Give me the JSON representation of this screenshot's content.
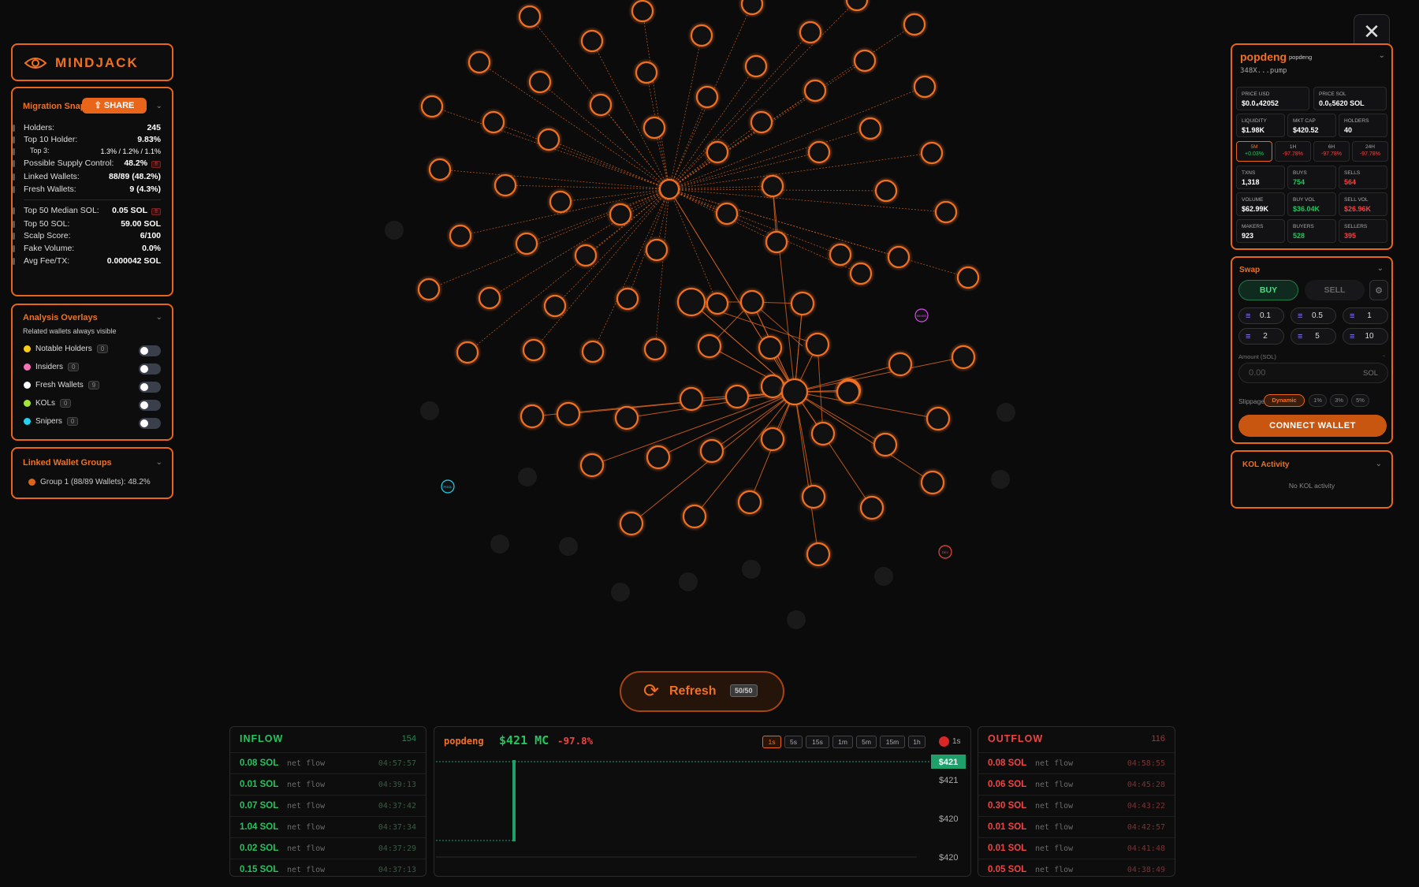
{
  "brand": {
    "name": "MINDJACK",
    "accent": "#f07022"
  },
  "close_icon": "close-icon",
  "migration": {
    "title": "Migration Snap",
    "share_label": "SHARE",
    "rows": [
      {
        "label": "Holders:",
        "value": "245"
      },
      {
        "label": "Top 10 Holder:",
        "value": "9.83%"
      },
      {
        "label": "Top 3:",
        "value": "1.3% / 1.2% / 1.1%"
      },
      {
        "label": "Possible Supply Control:",
        "value": "48.2%",
        "flag": "!!"
      },
      {
        "label": "Linked Wallets:",
        "value": "88/89 (48.2%)"
      },
      {
        "label": "Fresh Wallets:",
        "value": "9 (4.3%)"
      },
      {
        "label": "Top 50 Median SOL:",
        "value": "0.05 SOL",
        "flag": "!!"
      },
      {
        "label": "Top 50 SOL:",
        "value": "59.00 SOL"
      },
      {
        "label": "Scalp Score:",
        "value": "6/100"
      },
      {
        "label": "Fake Volume:",
        "value": "0.0%"
      },
      {
        "label": "Avg Fee/TX:",
        "value": "0.000042 SOL"
      }
    ]
  },
  "overlays": {
    "title": "Analysis Overlays",
    "subtitle": "Related wallets always visible",
    "items": [
      {
        "label": "Notable Holders",
        "count": "0",
        "color": "#facc15"
      },
      {
        "label": "Insiders",
        "count": "0",
        "color": "#f472b6"
      },
      {
        "label": "Fresh Wallets",
        "count": "9",
        "color": "#ffffff"
      },
      {
        "label": "KOLs",
        "count": "0",
        "color": "#a3e635"
      },
      {
        "label": "Snipers",
        "count": "0",
        "color": "#22d3ee"
      }
    ]
  },
  "groups": {
    "title": "Linked Wallet Groups",
    "items": [
      {
        "label": "Group 1 (88/89 Wallets): 48.2%",
        "color": "#d9641a"
      }
    ]
  },
  "token": {
    "name": "popdeng",
    "ticker": "popdeng",
    "address": "348X...pump",
    "cells": [
      {
        "label": "PRICE USD",
        "value": "$0.0₄42052"
      },
      {
        "label": "PRICE SOL",
        "value": "0.0₆5620 SOL"
      },
      {
        "label": "LIQUIDITY",
        "value": "$1.98K"
      },
      {
        "label": "MKT CAP",
        "value": "$420.52"
      },
      {
        "label": "HOLDERS",
        "value": "40"
      }
    ],
    "changes": [
      {
        "label": "5M",
        "value": "+0.03%"
      },
      {
        "label": "1H",
        "value": "-97.78%"
      },
      {
        "label": "6H",
        "value": "-97.78%"
      },
      {
        "label": "24H",
        "value": "-97.78%"
      }
    ],
    "stats": [
      {
        "label": "TXNS",
        "value": "1,318",
        "tone": ""
      },
      {
        "label": "BUYS",
        "value": "754",
        "tone": "green"
      },
      {
        "label": "SELLS",
        "value": "564",
        "tone": "red"
      },
      {
        "label": "VOLUME",
        "value": "$62.99K",
        "tone": ""
      },
      {
        "label": "BUY VOL",
        "value": "$36.04K",
        "tone": "green"
      },
      {
        "label": "SELL VOL",
        "value": "$26.96K",
        "tone": "red"
      },
      {
        "label": "MAKERS",
        "value": "923",
        "tone": ""
      },
      {
        "label": "BUYERS",
        "value": "528",
        "tone": "green"
      },
      {
        "label": "SELLERS",
        "value": "395",
        "tone": "red"
      }
    ]
  },
  "swap": {
    "title": "Swap",
    "buy_label": "BUY",
    "sell_label": "SELL",
    "amounts": [
      "0.1",
      "0.5",
      "1",
      "2",
      "5",
      "10"
    ],
    "amount_label": "Amount (SOL)",
    "amount_placeholder": "0.00",
    "unit": "SOL",
    "slippage_label": "Slippage",
    "slippage_options": [
      "Dynamic",
      "1%",
      "3%",
      "5%"
    ],
    "connect_label": "CONNECT WALLET"
  },
  "kol": {
    "title": "KOL Activity",
    "empty": "No KOL activity"
  },
  "refresh": {
    "label": "Refresh",
    "count": "50/50"
  },
  "graph_labels": {
    "pool": "POOL",
    "dev": "DEV",
    "mix": "MIXER"
  },
  "inflow": {
    "title": "INFLOW",
    "count": "154",
    "rows": [
      {
        "amount": "0.08 SOL",
        "note": "net flow",
        "time": "04:57:57"
      },
      {
        "amount": "0.01 SOL",
        "note": "net flow",
        "time": "04:39:13"
      },
      {
        "amount": "0.07 SOL",
        "note": "net flow",
        "time": "04:37:42"
      },
      {
        "amount": "1.04 SOL",
        "note": "net flow",
        "time": "04:37:34"
      },
      {
        "amount": "0.02 SOL",
        "note": "net flow",
        "time": "04:37:29"
      },
      {
        "amount": "0.15 SOL",
        "note": "net flow",
        "time": "04:37:13"
      }
    ]
  },
  "outflow": {
    "title": "OUTFLOW",
    "count": "116",
    "rows": [
      {
        "amount": "0.08 SOL",
        "note": "net flow",
        "time": "04:58:55"
      },
      {
        "amount": "0.06 SOL",
        "note": "net flow",
        "time": "04:45:28"
      },
      {
        "amount": "0.30 SOL",
        "note": "net flow",
        "time": "04:43:22"
      },
      {
        "amount": "0.01 SOL",
        "note": "net flow",
        "time": "04:42:57"
      },
      {
        "amount": "0.01 SOL",
        "note": "net flow",
        "time": "04:41:48"
      },
      {
        "amount": "0.05 SOL",
        "note": "net flow",
        "time": "04:38:49"
      }
    ]
  },
  "mini_chart": {
    "ticker": "popdeng",
    "mc": "$421 MC",
    "change": "-97.8%",
    "timeframes": [
      "1s",
      "5s",
      "15s",
      "1m",
      "5m",
      "15m",
      "1h"
    ],
    "interval": "1s",
    "price_tag": "$421",
    "ticks": [
      "$421",
      "$420",
      "$420"
    ]
  }
}
